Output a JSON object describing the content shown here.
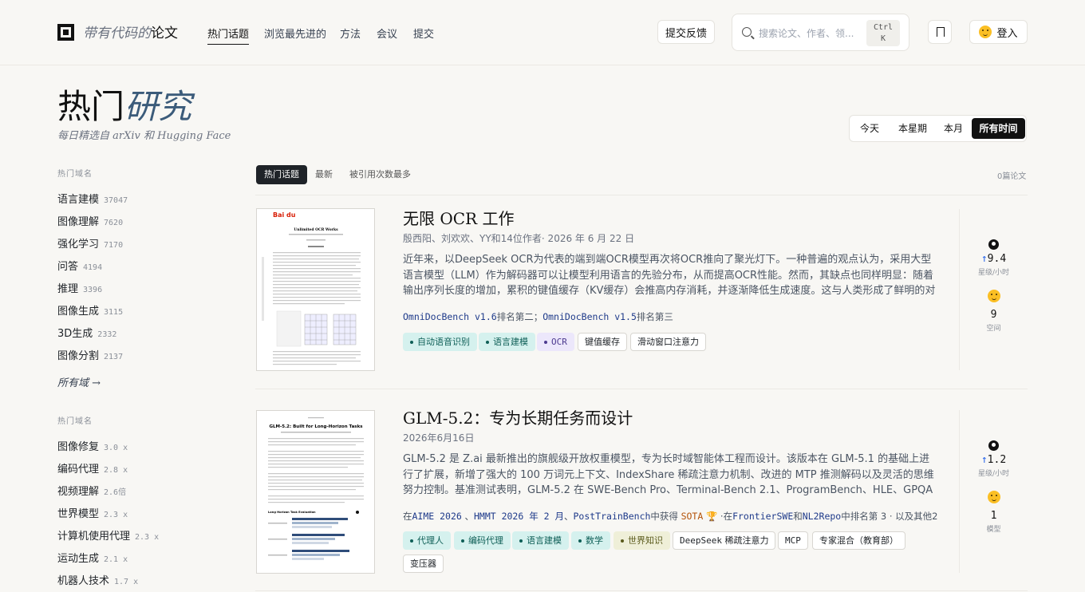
{
  "header": {
    "brand_italic": "带有代码的",
    "brand_bold": "论文",
    "nav": [
      "热门话题",
      "浏览最先进的",
      "方法",
      "会议",
      "提交"
    ],
    "feedback": "提交反馈",
    "search_placeholder": "搜索论文、作者、领...",
    "kbd_line1": "Ctrl",
    "kbd_line2": "K",
    "login": "登入"
  },
  "hero": {
    "title_plain": "热门",
    "title_italic": "研究",
    "subtitle": "每日精选自 arXiv 和 Hugging Face",
    "periods": [
      "今天",
      "本星期",
      "本月",
      "所有时间"
    ],
    "active_period": "所有时间"
  },
  "sidebar": {
    "heading1": "热门域名",
    "domains": [
      {
        "label": "语言建模",
        "count": "37047"
      },
      {
        "label": "图像理解",
        "count": "7620"
      },
      {
        "label": "强化学习",
        "count": "7170"
      },
      {
        "label": "问答",
        "count": "4194"
      },
      {
        "label": "推理",
        "count": "3396"
      },
      {
        "label": "图像生成",
        "count": "3115"
      },
      {
        "label": "3D生成",
        "count": "2332"
      },
      {
        "label": "图像分割",
        "count": "2137"
      }
    ],
    "all_domains": "所有域 →",
    "heading2": "热门域名",
    "trending": [
      {
        "label": "图像修复",
        "count": "3.0 x"
      },
      {
        "label": "编码代理",
        "count": "2.8 x"
      },
      {
        "label": "视频理解",
        "count": "2.6倍"
      },
      {
        "label": "世界模型",
        "count": "2.3 x"
      },
      {
        "label": "计算机使用代理",
        "count": "2.3 x"
      },
      {
        "label": "运动生成",
        "count": "2.1 x"
      },
      {
        "label": "机器人技术",
        "count": "1.7 x"
      }
    ]
  },
  "tabs": [
    "热门话题",
    "最新",
    "被引用次数最多"
  ],
  "paper_count": "0篇论文",
  "papers": [
    {
      "title": "无限 OCR 工作",
      "meta": "殷西阳、刘欢欢、YY和14位作者· 2026 年 6 月 22 日",
      "abstract": "近年来，以DeepSeek OCR为代表的端到端OCR模型再次将OCR推向了聚光灯下。一种普遍的观点认为，采用大型语言模型（LLM）作为解码器可以让模型利用语言的先验分布，从而提高OCR性能。然而，其缺点也同样明显：随着输出序列长度的增加，累积的键值缓存（KV缓存）会推高内存消耗，并逐渐降低生成速度。这与人类形成了鲜明的对比，人类在执...",
      "bench": {
        "b1": "OmniDocBench v1.6",
        "r1": "排名第二；",
        "b2": "OmniDocBench v1.5",
        "r2": "排名第三"
      },
      "chips": [
        "自动语音识别",
        "语言建模",
        "OCR",
        "键值缓存",
        "滑动窗口注意力"
      ],
      "stars": "9.4",
      "stars_label": "星级/小时",
      "hf": "9",
      "hf_label": "空间",
      "thumb_title": "Unlimited OCR Works",
      "thumb_logo": "Bai du"
    },
    {
      "title": "GLM-5.2：专为长期任务而设计",
      "meta": "2026年6月16日",
      "abstract": "GLM-5.2 是 Z.ai 最新推出的旗舰级开放权重模型，专为长时域智能体工程而设计。该版本在 GLM-5.1 的基础上进行了扩展，新增了强大的 100 万词元上下文、IndexShare 稀疏注意力机制、改进的 MTP 推测解码以及灵活的思维努力控制。基准测试表明，GLM-5.2 在 SWE-Bench Pro、Terminal-Bench 2.1、ProgramBench、HLE、GPQA Diamond、AIME...",
      "bench": {
        "pre": "在",
        "b1": "AIME 2026",
        "sep1": " 、",
        "b2": "HMMT 2026 年 2 月",
        "sep2": "、",
        "b3": "PostTrainBench",
        "mid": "中获得",
        "sota": "SOTA",
        "trophy": "🏆",
        "mid2": " ·在",
        "b4": "FrontierSWE",
        "and": "和",
        "b5": "NL2Repo",
        "rank": "中排名第 3 · 以及其他2"
      },
      "chips": [
        "代理人",
        "编码代理",
        "语言建模",
        "数学",
        "世界知识",
        "DeepSeek",
        "稀疏注意力",
        "MCP",
        "专家混合（教育部）",
        "变压器"
      ],
      "stars": "1.2",
      "stars_label": "星级/小时",
      "hf": "1",
      "hf_label": "模型",
      "thumb_title": "GLM-5.2: Built for Long-Horizon Tasks",
      "thumb_fig": "Long Horizon Task Evaluation"
    }
  ],
  "colors": {
    "accent_dark": "#1f2328",
    "teal_chip": "#d5f1ee",
    "purple_chip": "#ece7fb",
    "olive_chip": "#efefd8",
    "link_blue": "#1e3a8a"
  },
  "icons": [
    "logo-icon",
    "search-icon",
    "bookmark-icon",
    "hugging-face-icon",
    "github-icon",
    "trophy-icon"
  ]
}
